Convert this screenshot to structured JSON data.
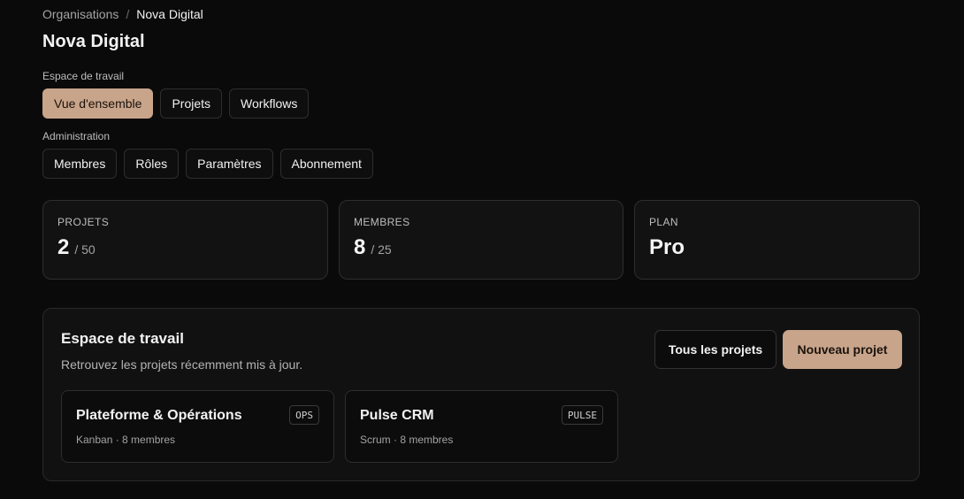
{
  "breadcrumb": {
    "parent": "Organisations",
    "separator": "/",
    "current": "Nova Digital"
  },
  "page_title": "Nova Digital",
  "workspace_nav": {
    "label": "Espace de travail",
    "items": [
      "Vue d'ensemble",
      "Projets",
      "Workflows"
    ],
    "active": "Vue d'ensemble"
  },
  "admin_nav": {
    "label": "Administration",
    "items": [
      "Membres",
      "Rôles",
      "Paramètres",
      "Abonnement"
    ]
  },
  "stats": [
    {
      "label": "PROJETS",
      "value": "2",
      "limit": "/ 50"
    },
    {
      "label": "MEMBRES",
      "value": "8",
      "limit": "/ 25"
    },
    {
      "label": "PLAN",
      "value": "Pro",
      "limit": ""
    }
  ],
  "workspace": {
    "title": "Espace de travail",
    "subtitle": "Retrouvez les projets récemment mis à jour.",
    "all_projects_label": "Tous les projets",
    "new_project_label": "Nouveau projet",
    "projects": [
      {
        "name": "Plateforme & Opérations",
        "tag": "OPS",
        "meta": "Kanban · 8 membres"
      },
      {
        "name": "Pulse CRM",
        "tag": "PULSE",
        "meta": "Scrum · 8 membres"
      }
    ]
  },
  "colors": {
    "accent": "#c8a48a",
    "background": "#0a0a0a",
    "card": "#121212",
    "border": "#2e2e2e"
  }
}
